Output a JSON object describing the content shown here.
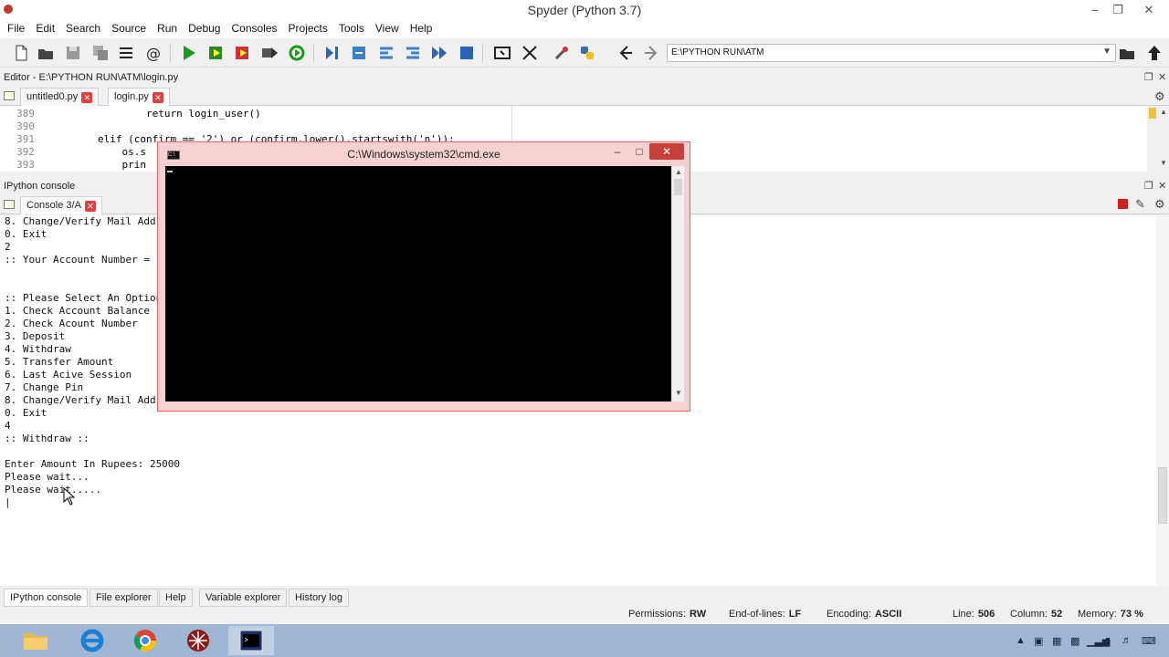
{
  "window": {
    "title": "Spyder (Python 3.7)"
  },
  "menu": [
    "File",
    "Edit",
    "Search",
    "Source",
    "Run",
    "Debug",
    "Consoles",
    "Projects",
    "Tools",
    "View",
    "Help"
  ],
  "toolbar": {
    "path": "E:\\PYTHON RUN\\ATM",
    "icons": [
      "new-file-icon",
      "open-file-icon",
      "save-icon",
      "save-all-icon",
      "outline-icon",
      "at-icon",
      "run-icon",
      "run-cell-icon",
      "run-cell-advance-icon",
      "run-selection-icon",
      "rerun-icon",
      "debug-icon",
      "step-icon",
      "step-into-icon",
      "step-return-icon",
      "continue-icon",
      "stop-icon",
      "maximize-pane-icon",
      "fullscreen-icon",
      "preferences-icon",
      "python-path-icon",
      "back-icon",
      "forward-icon",
      "browse-folder-icon",
      "parent-folder-icon"
    ]
  },
  "editor": {
    "header": "Editor - E:\\PYTHON RUN\\ATM\\login.py",
    "tabs": [
      {
        "label": "untitled0.py"
      },
      {
        "label": "login.py"
      }
    ],
    "lines": [
      {
        "num": "389",
        "code": "                return login_user()"
      },
      {
        "num": "390",
        "code": ""
      },
      {
        "num": "391",
        "code": "        elif (confirm == '2') or (confirm.lower().startswith('n')):"
      },
      {
        "num": "392",
        "code": "            os.s"
      },
      {
        "num": "393",
        "code": "            prin"
      }
    ]
  },
  "console_pane": {
    "header": "IPython console",
    "tab": "Console 3/A",
    "lines": [
      "8. Change/Verify Mail Addr",
      "0. Exit",
      "2",
      ":: Your Account Number = ",
      "",
      "",
      ":: Please Select An Option",
      "1. Check Account Balance",
      "2. Check Acount Number",
      "3. Deposit",
      "4. Withdraw",
      "5. Transfer Amount",
      "6. Last Acive Session",
      "7. Change Pin",
      "8. Change/Verify Mail Addr",
      "0. Exit",
      "4",
      ":: Withdraw ::",
      "",
      "Enter Amount In Rupees: 25000",
      "Please wait...",
      "Please wait.....",
      "|"
    ]
  },
  "bottom_tabs": [
    "IPython console",
    "File explorer",
    "Help",
    "Variable explorer",
    "History log"
  ],
  "status": {
    "permissions_label": "Permissions:",
    "permissions": "RW",
    "eol_label": "End-of-lines:",
    "eol": "LF",
    "encoding_label": "Encoding:",
    "encoding": "ASCII",
    "line_label": "Line:",
    "line": "506",
    "column_label": "Column:",
    "column": "52",
    "memory_label": "Memory:",
    "memory": "73 %"
  },
  "cmd_window": {
    "title": "C:\\Windows\\system32\\cmd.exe"
  },
  "taskbar": {
    "apps": [
      "file-explorer-icon",
      "internet-explorer-icon",
      "chrome-icon",
      "spyder-icon",
      "cmd-icon"
    ]
  }
}
